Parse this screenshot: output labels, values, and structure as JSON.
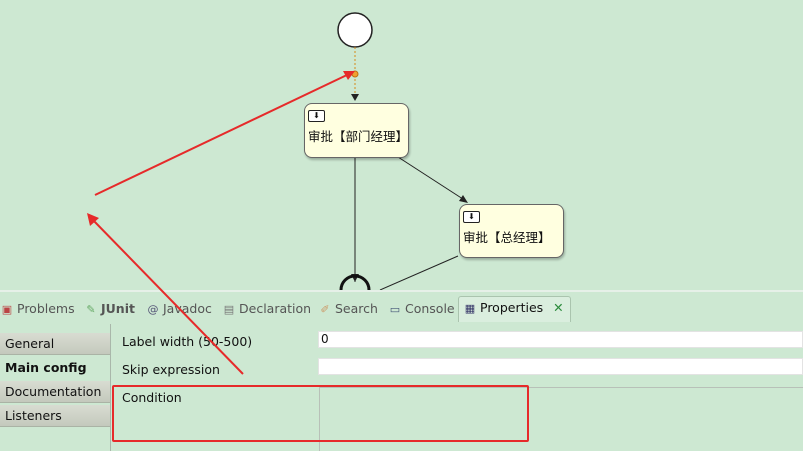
{
  "diagram": {
    "tasks": [
      {
        "label": "审批【部门经理】"
      },
      {
        "label": "审批【总经理】"
      }
    ],
    "task_icon": "user-task-icon"
  },
  "views": {
    "tabs": [
      {
        "label": "Problems",
        "icon": "problems-icon"
      },
      {
        "label": "JUnit",
        "icon": "junit-icon"
      },
      {
        "label": "Javadoc",
        "icon": "javadoc-icon"
      },
      {
        "label": "Declaration",
        "icon": "declaration-icon"
      },
      {
        "label": "Search",
        "icon": "search-icon"
      },
      {
        "label": "Console",
        "icon": "console-icon"
      },
      {
        "label": "Properties",
        "icon": "properties-icon",
        "active": true
      }
    ]
  },
  "properties": {
    "sections": [
      "General",
      "Main config",
      "Documentation",
      "Listeners"
    ],
    "active_section": "Main config",
    "fields": {
      "label_width": {
        "label": "Label width (50-500)",
        "value": "0"
      },
      "skip_expression": {
        "label": "Skip expression",
        "value": ""
      },
      "condition": {
        "label": "Condition",
        "value": ""
      }
    }
  },
  "colors": {
    "background": "#cde8d2",
    "task_fill": "#ffffe0",
    "annotation": "#e62a2a"
  }
}
